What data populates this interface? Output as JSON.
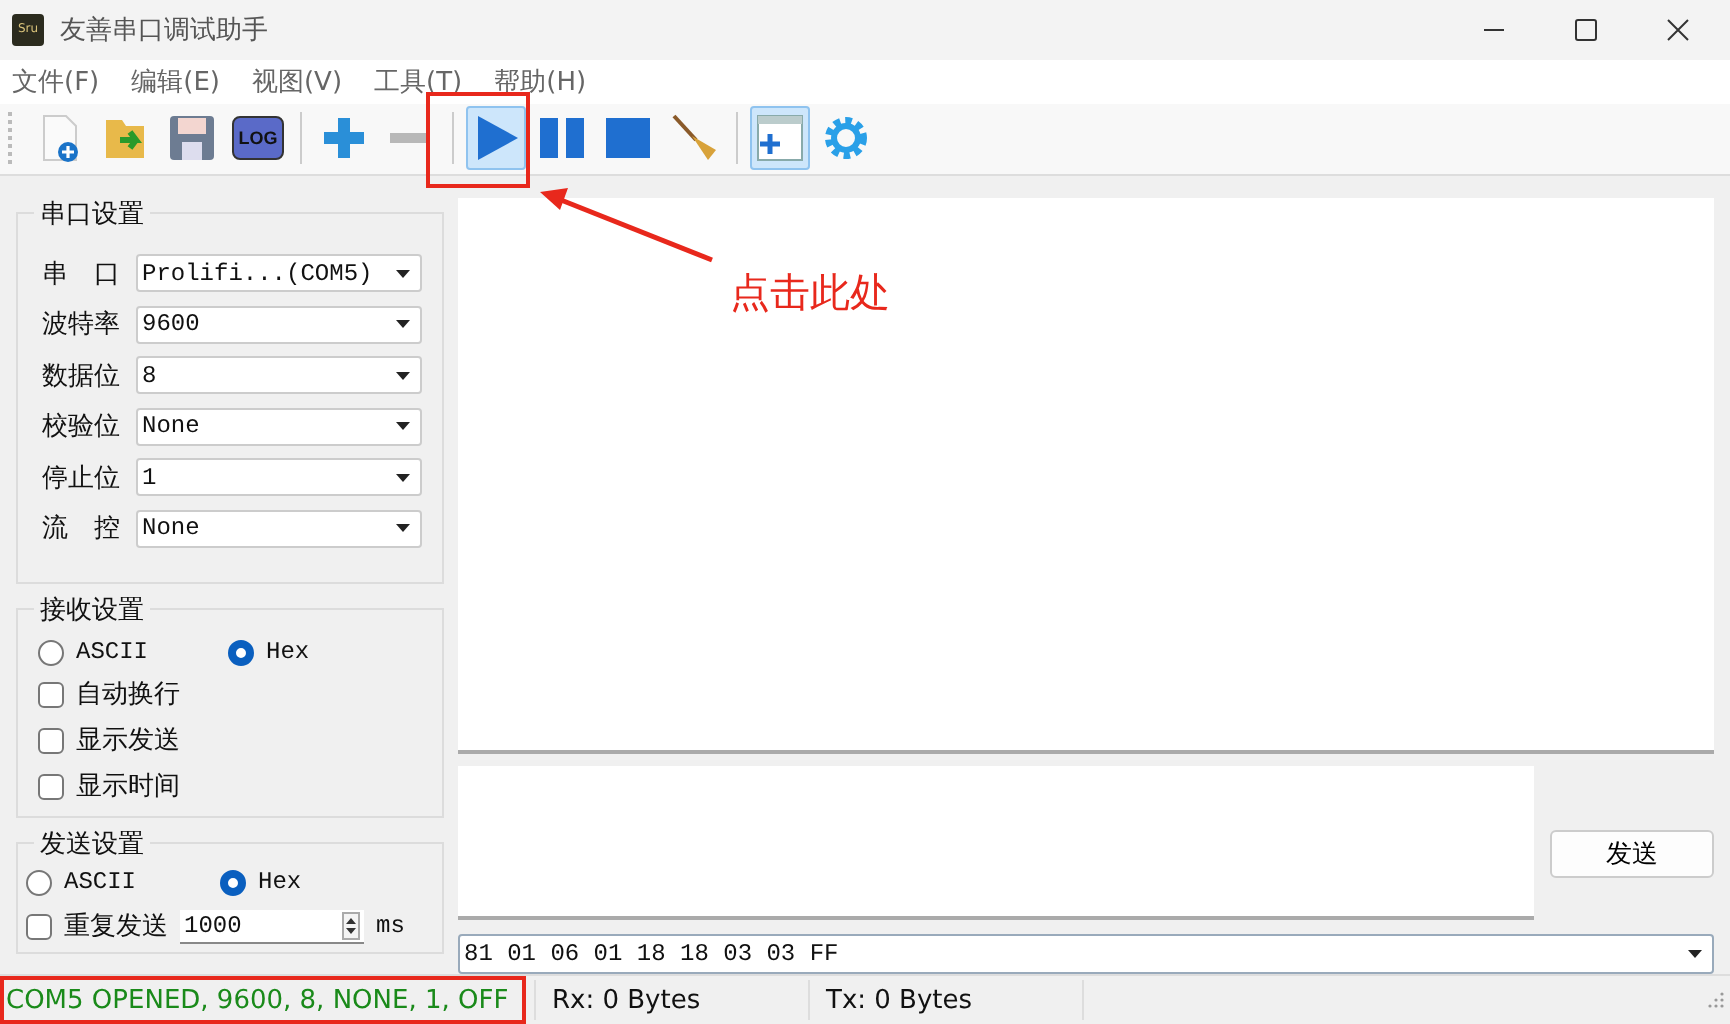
{
  "window": {
    "title": "友善串口调试助手",
    "app_icon": "Sru"
  },
  "menu": [
    "文件(F)",
    "编辑(E)",
    "视图(V)",
    "工具(T)",
    "帮助(H)"
  ],
  "toolbar": [
    {
      "kind": "new",
      "highlighted": false
    },
    {
      "kind": "open",
      "highlighted": false
    },
    {
      "kind": "save",
      "highlighted": false
    },
    {
      "kind": "log",
      "label": "LOG",
      "highlighted": false
    },
    {
      "kind": "sep"
    },
    {
      "kind": "plus",
      "highlighted": false
    },
    {
      "kind": "minus",
      "highlighted": false
    },
    {
      "kind": "sep"
    },
    {
      "kind": "play",
      "highlighted": true
    },
    {
      "kind": "pause",
      "highlighted": false
    },
    {
      "kind": "stop",
      "highlighted": false
    },
    {
      "kind": "broom",
      "highlighted": false
    },
    {
      "kind": "sep"
    },
    {
      "kind": "window",
      "highlighted": true
    },
    {
      "kind": "gear",
      "highlighted": false
    }
  ],
  "serial_settings": {
    "title": "串口设置",
    "fields": [
      {
        "label": "串　口",
        "value": "Prolifi...(COM5)"
      },
      {
        "label": "波特率",
        "value": "9600"
      },
      {
        "label": "数据位",
        "value": "8"
      },
      {
        "label": "校验位",
        "value": "None"
      },
      {
        "label": "停止位",
        "value": "1"
      },
      {
        "label": "流　控",
        "value": "None"
      }
    ]
  },
  "receive_settings": {
    "title": "接收设置",
    "modes": [
      {
        "label": "ASCII",
        "selected": false
      },
      {
        "label": "Hex",
        "selected": true
      }
    ],
    "options": [
      {
        "label": "自动换行",
        "checked": false
      },
      {
        "label": "显示发送",
        "checked": false
      },
      {
        "label": "显示时间",
        "checked": false
      }
    ]
  },
  "send_settings": {
    "title": "发送设置",
    "modes": [
      {
        "label": "ASCII",
        "selected": false
      },
      {
        "label": "Hex",
        "selected": true
      }
    ],
    "repeat": {
      "label": "重复发送",
      "checked": false,
      "interval": "1000",
      "unit": "ms"
    }
  },
  "send_button": "发送",
  "send_history": "81 01 06 01 18 18 03 03 FF",
  "status_bar": {
    "port_status": "COM5 OPENED, 9600, 8, NONE, 1, OFF",
    "rx": "Rx: 0 Bytes",
    "tx": "Tx: 0 Bytes"
  },
  "annotation": {
    "callout": "点击此处"
  }
}
